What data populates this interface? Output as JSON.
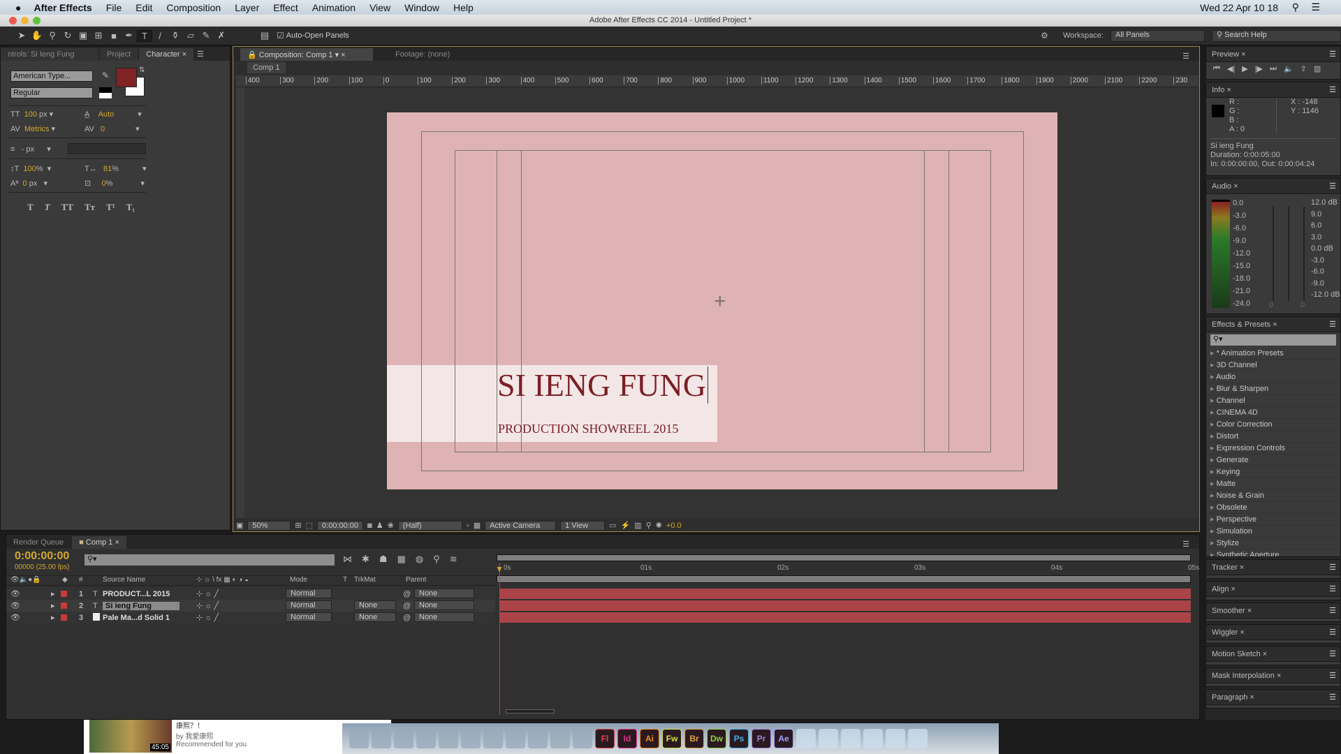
{
  "menubar": {
    "app": "After Effects",
    "items": [
      "File",
      "Edit",
      "Composition",
      "Layer",
      "Effect",
      "Animation",
      "View",
      "Window",
      "Help"
    ],
    "clock": "Wed 22 Apr  10 18"
  },
  "window": {
    "title": "Adobe After Effects CC 2014 - Untitled Project *"
  },
  "toolbar": {
    "auto_open": "Auto-Open Panels",
    "workspace_label": "Workspace:",
    "workspace": "All Panels",
    "search_placeholder": "Search Help"
  },
  "left_panel": {
    "tabs": [
      "ntrols: Si Ieng Fung",
      "Project",
      "Character"
    ],
    "font": "American Type...",
    "style": "Regular",
    "fill_color": "#7f2327",
    "size": "100",
    "size_unit": "px",
    "leading": "Auto",
    "kerning": "Metrics",
    "tracking": "0",
    "stroke_width": "-",
    "stroke_unit": "px",
    "vscale": "100",
    "vscale_unit": "%",
    "hscale": "81",
    "hscale_unit": "%",
    "baseline": "0",
    "baseline_unit": "px",
    "tsume": "0",
    "tsume_unit": "%",
    "styles": [
      "T",
      "T",
      "TT",
      "Tт",
      "T¹",
      "T₁"
    ]
  },
  "comp_panel": {
    "tab": "Composition: Comp 1",
    "footage": "Footage: (none)",
    "breadcrumb": "Comp 1",
    "ruler": [
      "400",
      "300",
      "200",
      "100",
      "0",
      "100",
      "200",
      "300",
      "400",
      "500",
      "600",
      "700",
      "800",
      "900",
      "1000",
      "1100",
      "1200",
      "1300",
      "1400",
      "1500",
      "1600",
      "1700",
      "1800",
      "1900",
      "2000",
      "2100",
      "2200",
      "230"
    ],
    "canvas_color": "#dfb3b4",
    "title_text": "SI IENG FUNG",
    "subtitle_text": "PRODUCTION SHOWREEL 2015",
    "text_color": "#7a1f25",
    "zoom": "50%",
    "timecode": "0:00:00:00",
    "resolution": "(Half)",
    "camera": "Active Camera",
    "views": "1 View",
    "exposure": "+0.0"
  },
  "preview": {
    "title": "Preview"
  },
  "info": {
    "title": "Info",
    "r": "R :",
    "g": "G :",
    "b": "B :",
    "a": "A : 0",
    "x": "X : -148",
    "y": "Y : 1146",
    "layer": "Si ieng Fung",
    "duration": "Duration: 0:00:05:00",
    "inout": "In: 0:00:00:00, Out: 0:00:04:24"
  },
  "audio": {
    "title": "Audio",
    "left": [
      "0.0",
      "-3.0",
      "-6.0",
      "-9.0",
      "-12.0",
      "-15.0",
      "-18.0",
      "-21.0",
      "-24.0"
    ],
    "right": [
      "12.0 dB",
      "9.0",
      "6.0",
      "3.0",
      "0.0 dB",
      "-3.0",
      "-6.0",
      "-9.0",
      "-12.0 dB"
    ],
    "zero": "0"
  },
  "effects": {
    "title": "Effects & Presets",
    "items": [
      "* Animation Presets",
      "3D Channel",
      "Audio",
      "Blur & Sharpen",
      "Channel",
      "CINEMA 4D",
      "Color Correction",
      "Distort",
      "Expression Controls",
      "Generate",
      "Keying",
      "Matte",
      "Noise & Grain",
      "Obsolete",
      "Perspective",
      "Simulation",
      "Stylize",
      "Synthetic Aperture"
    ]
  },
  "collapsed_panels": [
    "Tracker",
    "Align",
    "Smoother",
    "Wiggler",
    "Motion Sketch",
    "Mask Interpolation",
    "Paragraph"
  ],
  "timeline": {
    "tabs": [
      "Render Queue",
      "Comp 1"
    ],
    "timecode": "0:00:00:00",
    "fps": "00000 (25.00 fps)",
    "headers": {
      "num": "#",
      "source": "Source Name",
      "mode": "Mode",
      "t": "T",
      "trkmat": "TrkMat",
      "parent": "Parent"
    },
    "ticks": [
      "0s",
      "01s",
      "02s",
      "03s",
      "04s",
      "05s"
    ],
    "layers": [
      {
        "num": "1",
        "type": "T",
        "name": "PRODUCT...L 2015",
        "mode": "Normal",
        "trkmat": "",
        "parent": "None",
        "color": "#c83a3a"
      },
      {
        "num": "2",
        "type": "T",
        "name": "Si ieng Fung",
        "mode": "Normal",
        "trkmat": "None",
        "parent": "None",
        "color": "#c83a3a"
      },
      {
        "num": "3",
        "type": "solid",
        "name": "Pale Ma...d Solid 1",
        "mode": "Normal",
        "trkmat": "None",
        "parent": "None",
        "color": "#c83a3a"
      }
    ]
  },
  "browser": {
    "by": "by 我愛康熙",
    "rec": "Recommended for you",
    "time": "45:05",
    "title": "康熙？！"
  },
  "dock": [
    "Fl",
    "Id",
    "Ai",
    "Fw",
    "Br",
    "Dw",
    "Ps",
    "Pr",
    "Ae"
  ]
}
